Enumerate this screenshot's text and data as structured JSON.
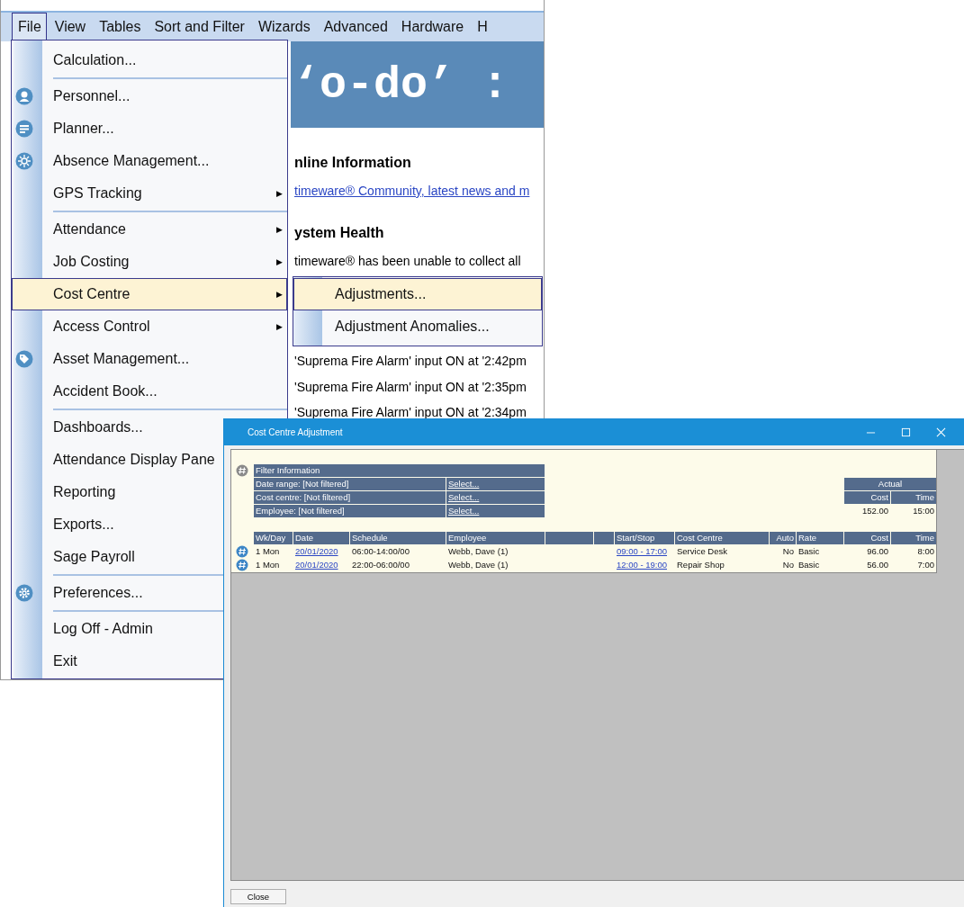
{
  "app": {
    "menu_bar": [
      {
        "label": "File",
        "selected": true
      },
      {
        "label": "View",
        "selected": false
      },
      {
        "label": "Tables",
        "selected": false
      },
      {
        "label": "Sort and Filter",
        "selected": false
      },
      {
        "label": "Wizards",
        "selected": false
      },
      {
        "label": "Advanced",
        "selected": false
      },
      {
        "label": "Hardware",
        "selected": false
      },
      {
        "label": "H",
        "selected": false
      }
    ],
    "content": {
      "banner": "‘o-do’ :",
      "sections": [
        {
          "heading": "nline Information",
          "text": "timeware® Community, latest news and m",
          "kind": "link"
        },
        {
          "heading": "ystem Health",
          "text": "timeware® has been unable to collect all",
          "kind": "plain"
        }
      ],
      "messages": [
        "'Suprema Fire Alarm' input ON at '2:42pm",
        "'Suprema Fire Alarm' input ON at '2:35pm",
        "'Suprema Fire Alarm' input ON at '2:34pm"
      ]
    }
  },
  "file_menu": {
    "groups": [
      [
        {
          "label": "Calculation...",
          "selected": false
        }
      ],
      [
        {
          "label": "Personnel...",
          "selected": false
        },
        {
          "label": "Planner...",
          "selected": false
        },
        {
          "label": "Absence Management...",
          "selected": false
        },
        {
          "label": "GPS Tracking",
          "arrow": "▶",
          "selected": false
        }
      ],
      [
        {
          "label": "Attendance",
          "arrow": "▶",
          "selected": false
        },
        {
          "label": "Job Costing",
          "arrow": "▶",
          "selected": false
        },
        {
          "label": "Cost Centre",
          "arrow": "▶",
          "selected": true
        },
        {
          "label": "Access Control",
          "arrow": "▶",
          "selected": false
        },
        {
          "label": "Asset Management...",
          "selected": false
        },
        {
          "label": "Accident Book...",
          "selected": false
        }
      ],
      [
        {
          "label": "Dashboards...",
          "selected": false
        },
        {
          "label": "Attendance Display Pane",
          "selected": false
        },
        {
          "label": "Reporting",
          "selected": false
        },
        {
          "label": "Exports...",
          "selected": false
        },
        {
          "label": "Sage Payroll",
          "selected": false
        }
      ],
      [
        {
          "label": "Preferences...",
          "selected": false
        }
      ],
      [
        {
          "label": "Log Off - Admin",
          "selected": false
        },
        {
          "label": "Exit",
          "selected": false
        }
      ]
    ]
  },
  "submenu": {
    "items": [
      {
        "label": "Adjustments...",
        "selected": true
      },
      {
        "label": "Adjustment Anomalies...",
        "selected": false
      }
    ]
  },
  "dialog": {
    "title": "Cost Centre Adjustment",
    "filter": {
      "title": "Filter Information",
      "rows": [
        {
          "label": "Date range: [Not filtered]",
          "action": "Select..."
        },
        {
          "label": "Cost centre: [Not filtered]",
          "action": "Select..."
        },
        {
          "label": "Employee: [Not filtered]",
          "action": "Select..."
        }
      ]
    },
    "summary": {
      "title": "Actual",
      "columns": [
        "Cost",
        "Time"
      ],
      "values": [
        "152.00",
        "15:00"
      ]
    },
    "columns": [
      "Wk/Day",
      "Date",
      "Schedule",
      "Employee",
      "Start/Stop",
      "Cost Centre",
      "Auto",
      "Rate",
      "Cost",
      "Time"
    ],
    "rows": [
      {
        "cells": [
          "1 Mon",
          "20/01/2020",
          "06:00-14:00/00",
          "Webb, Dave (1)",
          "09:00 - 17:00",
          "Service Desk",
          "No",
          "Basic",
          "96.00",
          "8:00"
        ]
      },
      {
        "cells": [
          "1 Mon",
          "20/01/2020",
          "22:00-06:00/00",
          "Webb, Dave (1)",
          "12:00 - 19:00",
          "Repair Shop",
          "No",
          "Basic",
          "56.00",
          "7:00"
        ]
      }
    ],
    "buttons": [
      "Close"
    ]
  }
}
